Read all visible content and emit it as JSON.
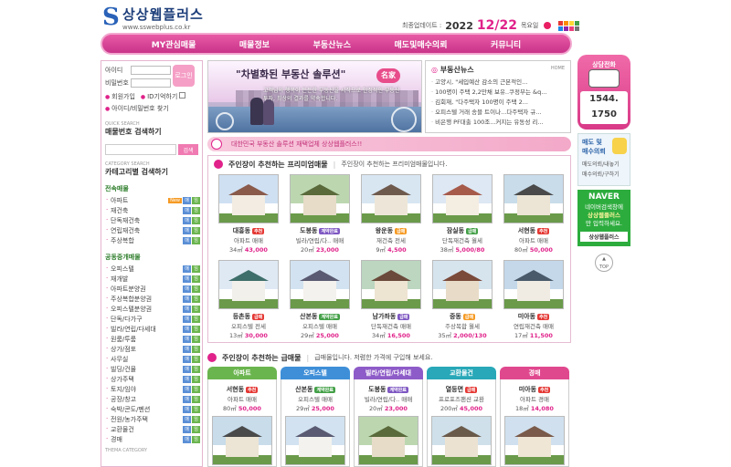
{
  "header": {
    "logo_letter": "S",
    "logo_title": "상상웹플러스",
    "logo_url": "www.sswebplus.co.kr",
    "update_label": "최종업데이트 :",
    "update_year": "2022",
    "update_date": "12/22",
    "update_day": "목요일",
    "swatch_colors": [
      "#e53935",
      "#fb8c00",
      "#fdd835",
      "#43a047",
      "#1e88e5",
      "#8e24aa",
      "#ec407a",
      "#757575"
    ]
  },
  "nav": [
    "MY관심매물",
    "매물정보",
    "부동산뉴스",
    "매도및매수의뢰",
    "커뮤니티"
  ],
  "login": {
    "id_label": "아이디",
    "pw_label": "비밀번호",
    "button": "로그인",
    "links": [
      "회원가입",
      "ID기억하기",
      "아이디/비밀번호 찾기"
    ]
  },
  "quick": {
    "small": "QUICK SEARCH",
    "title": "매물번호 검색하기",
    "button": "검색"
  },
  "category": {
    "small": "CATEGORY SEARCH",
    "title": "카테고리별 검색하기",
    "group1": "전속매물",
    "group1_items": [
      "아파트",
      "재건축",
      "단독재건축",
      "연립재건축",
      "주상복합"
    ],
    "hot": "New",
    "group2": "공동중개매물",
    "group2_items": [
      "오피스텔",
      "재개발",
      "아파트분양권",
      "주상복합분양권",
      "오피스텔분양권",
      "단독/다가구",
      "빌라/연립/다세대",
      "원룸/투룸",
      "상가/점포",
      "사무실",
      "빌딩/건물",
      "상가주택",
      "토지/임야",
      "공장/창고",
      "숙박/콘도/펜션",
      "전원/농가주택",
      "교환물건",
      "경매"
    ],
    "badge1": "매",
    "badge2": "임",
    "theme_small": "THEMA CATEGORY"
  },
  "banner": {
    "slogan": "\"차별화된 부동산 솔루션\"",
    "badge": "名家",
    "sub": "고객님의 행복이 든든한 부동산을 시작으로 안정적인 부동산 투자, 최상의 결과를 약속합니다."
  },
  "news": {
    "title": "부동산뉴스",
    "home": "HOME",
    "items": [
      "고양시, \"세입예산 감소의 근본적인...",
      "100명이 주택 2,2만채 보유..쿠정부는 &q...",
      "김회재, \"다주택자 100명이 주택 2...",
      "오피스텔 거래 송블 트이나...다주택자 규...",
      "비은행 PF대출 100조...커지는 유동성 리..."
    ]
  },
  "ticker": "대한민국 부동산 솔루션 재택업체 상상웹플러스!!",
  "premium": {
    "title": "주인장이 추천하는 프리미엄매물",
    "sub": "주인장이 추천하는 프리미엄매물입니다.",
    "cards": [
      {
        "loc": "대흥동",
        "tag": "추천",
        "tag_color": "#e53935",
        "type": "아파트 매매",
        "area": "34㎡",
        "price": "43,000",
        "sky": "#cfe0f2",
        "roof": "#8a5a4a",
        "wall": "#f2ece2"
      },
      {
        "loc": "도봉동",
        "tag": "계약완료",
        "tag_color": "#7e57c2",
        "type": "빌라/연립/다.. 매매",
        "area": "20㎡",
        "price": "23,000",
        "sky": "#bcd7b0",
        "roof": "#5a6a3a",
        "wall": "#e6dcc8"
      },
      {
        "loc": "왕운동",
        "tag": "급매",
        "tag_color": "#f59a23",
        "type": "재건축 전세",
        "area": "9㎡",
        "price": "4,500",
        "sky": "#d8e6f2",
        "roof": "#6e5a4d",
        "wall": "#ede6d8"
      },
      {
        "loc": "잠실동",
        "tag": "급매",
        "tag_color": "#43a047",
        "type": "단독재건축 월세",
        "area": "38㎡",
        "price": "5,000/80",
        "sky": "#dde8f4",
        "roof": "#a65a4a",
        "wall": "#f4ede2"
      },
      {
        "loc": "서현동",
        "tag": "추천",
        "tag_color": "#e53935",
        "type": "아파트 매매",
        "area": "80㎡",
        "price": "50,000",
        "sky": "#c8dcea",
        "roof": "#4a4a4a",
        "wall": "#ece4d4"
      },
      {
        "loc": "등촌동",
        "tag": "급매",
        "tag_color": "#e53935",
        "type": "오피스텔 전세",
        "area": "13㎡",
        "price": "30,000",
        "sky": "#dfe9f4",
        "roof": "#3f6f6a",
        "wall": "#f2f0ea"
      },
      {
        "loc": "산본동",
        "tag": "계약완료",
        "tag_color": "#43a047",
        "type": "오피스텔 매매",
        "area": "29㎡",
        "price": "25,000",
        "sky": "#d2e2f0",
        "roof": "#5a5a72",
        "wall": "#f4f2ee"
      },
      {
        "loc": "남가좌동",
        "tag": "급매",
        "tag_color": "#7e57c2",
        "type": "단독재건축 매매",
        "area": "34㎡",
        "price": "16,500",
        "sky": "#bcd6c0",
        "roof": "#6a4a3a",
        "wall": "#eee4d2"
      },
      {
        "loc": "중동",
        "tag": "급매",
        "tag_color": "#f59a23",
        "type": "주상복합 월세",
        "area": "35㎡",
        "price": "2,000/130",
        "sky": "#d6e4ee",
        "roof": "#7a4a3a",
        "wall": "#e8dcc8"
      },
      {
        "loc": "미아동",
        "tag": "추천",
        "tag_color": "#e53935",
        "type": "연립재건축 매매",
        "area": "17㎡",
        "price": "11,500",
        "sky": "#c4d8ea",
        "roof": "#4a5a6a",
        "wall": "#f0ece4"
      }
    ]
  },
  "urgent": {
    "title": "주인장이 추천하는 급매물",
    "sub": "급매물입니다. 저렴한 가격에 구입해 보세요.",
    "tabs": [
      {
        "label": "아파트",
        "color": "#6bb54f",
        "loc": "서현동",
        "tag": "추천",
        "tag_color": "#e53935",
        "type": "아파트 매매",
        "area": "80㎡",
        "price": "50,000",
        "sky": "#c8dcea",
        "roof": "#4a4a4a",
        "wall": "#ece4d4"
      },
      {
        "label": "오피스텔",
        "color": "#3f8fd8",
        "loc": "산본동",
        "tag": "계약완료",
        "tag_color": "#43a047",
        "type": "오피스텔 매매",
        "area": "29㎡",
        "price": "25,000",
        "sky": "#d2e2f0",
        "roof": "#5a5a72",
        "wall": "#f4f2ee"
      },
      {
        "label": "빌라/연립/다세대",
        "color": "#8e5cc8",
        "loc": "도봉동",
        "tag": "계약완료",
        "tag_color": "#7e57c2",
        "type": "빌라/연립/다.. 매매",
        "area": "20㎡",
        "price": "23,000",
        "sky": "#bcd7b0",
        "roof": "#5a6a3a",
        "wall": "#e6dcc8"
      },
      {
        "label": "교환물건",
        "color": "#28a8b8",
        "loc": "열등면",
        "tag": "급매",
        "tag_color": "#e53935",
        "type": "프로포즈팬션 교환",
        "area": "200㎡",
        "price": "45,000",
        "sky": "#cfe0ea",
        "roof": "#6a5a4a",
        "wall": "#ebe2d2"
      },
      {
        "label": "경매",
        "color": "#e0488e",
        "loc": "미아동",
        "tag": "추천",
        "tag_color": "#e53935",
        "type": "아파트 경매",
        "area": "18㎡",
        "price": "14,080",
        "sky": "#d0e0ee",
        "roof": "#7a5a4a",
        "wall": "#efe6d6"
      }
    ]
  },
  "right": {
    "phone_title": "상담전화",
    "phone_line1": "1544.",
    "phone_line2": "1750",
    "sell_title1": "매도 및",
    "sell_title2": "매수의뢰",
    "sell_links": [
      "매도의뢰/내놓기",
      "매수의뢰/구하기"
    ],
    "naver_logo": "NAVER",
    "naver_text1": "네이버검색창에",
    "naver_text2": "상상웹플러스",
    "naver_text3": "만 입력하세요.",
    "naver_bar": "상상웹플러스",
    "top": "TOP"
  }
}
